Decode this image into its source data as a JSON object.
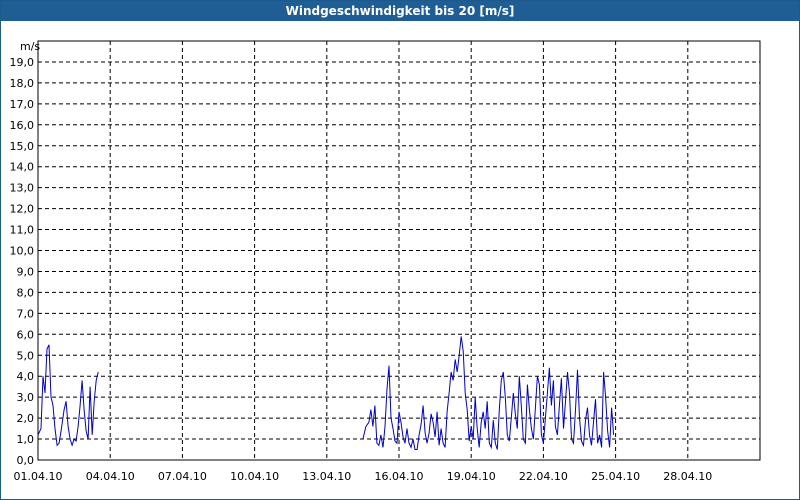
{
  "window": {
    "title": "Windgeschwindigkeit bis 20 [m/s]"
  },
  "chart_data": {
    "type": "line",
    "title": "Windgeschwindigkeit bis 20 [m/s]",
    "ylabel": "m/s",
    "xlabel": "",
    "ylim": [
      0,
      20
    ],
    "xlim": [
      "01.04.10",
      "30.04.10"
    ],
    "grid": true,
    "y_ticks": [
      "0,0",
      "1,0",
      "2,0",
      "3,0",
      "4,0",
      "5,0",
      "6,0",
      "7,0",
      "8,0",
      "9,0",
      "10,0",
      "11,0",
      "12,0",
      "13,0",
      "14,0",
      "15,0",
      "16,0",
      "17,0",
      "18,0",
      "19,0"
    ],
    "x_ticks": [
      "01.04.10",
      "04.04.10",
      "07.04.10",
      "10.04.10",
      "13.04.10",
      "16.04.10",
      "19.04.10",
      "22.04.10",
      "25.04.10",
      "28.04.10"
    ],
    "line_color": "#0000cc",
    "series": [
      {
        "segments": [
          [
            [
              "01.04.10 00:00",
              1.2
            ],
            [
              "01.04.10 03:00",
              1.5
            ],
            [
              "01.04.10 05:00",
              4.0
            ],
            [
              "01.04.10 07:00",
              3.2
            ],
            [
              "01.04.10 09:00",
              5.3
            ],
            [
              "01.04.10 11:00",
              5.5
            ],
            [
              "01.04.10 13:00",
              3.0
            ],
            [
              "01.04.10 15:00",
              2.6
            ],
            [
              "01.04.10 17:00",
              1.5
            ],
            [
              "01.04.10 19:00",
              0.7
            ],
            [
              "01.04.10 21:00",
              0.8
            ],
            [
              "01.04.10 23:00",
              1.4
            ],
            [
              "02.04.10 02:00",
              2.4
            ],
            [
              "02.04.10 04:00",
              2.8
            ],
            [
              "02.04.10 06:00",
              1.6
            ],
            [
              "02.04.10 08:00",
              1.0
            ],
            [
              "02.04.10 10:00",
              0.7
            ],
            [
              "02.04.10 12:00",
              1.0
            ],
            [
              "02.04.10 14:00",
              0.9
            ],
            [
              "02.04.10 16:00",
              1.6
            ],
            [
              "02.04.10 18:00",
              2.6
            ],
            [
              "02.04.10 20:00",
              3.8
            ],
            [
              "02.04.10 22:00",
              2.4
            ],
            [
              "03.04.10 00:00",
              1.4
            ],
            [
              "03.04.10 02:00",
              1.0
            ],
            [
              "03.04.10 04:00",
              3.5
            ],
            [
              "03.04.10 06:00",
              1.2
            ],
            [
              "03.04.10 08:00",
              2.8
            ],
            [
              "03.04.10 10:00",
              3.8
            ],
            [
              "03.04.10 12:00",
              4.2
            ]
          ],
          [
            [
              "14.04.10 12:00",
              1.0
            ],
            [
              "14.04.10 15:00",
              1.6
            ],
            [
              "14.04.10 18:00",
              1.8
            ],
            [
              "14.04.10 20:00",
              2.4
            ],
            [
              "14.04.10 22:00",
              1.6
            ],
            [
              "15.04.10 00:00",
              2.6
            ],
            [
              "15.04.10 02:00",
              0.8
            ],
            [
              "15.04.10 04:00",
              0.7
            ],
            [
              "15.04.10 06:00",
              1.2
            ],
            [
              "15.04.10 08:00",
              0.6
            ],
            [
              "15.04.10 10:00",
              1.6
            ],
            [
              "15.04.10 12:00",
              3.4
            ],
            [
              "15.04.10 14:00",
              4.5
            ],
            [
              "15.04.10 16:00",
              2.0
            ],
            [
              "15.04.10 18:00",
              1.5
            ],
            [
              "15.04.10 20:00",
              0.9
            ],
            [
              "15.04.10 22:00",
              0.8
            ],
            [
              "16.04.10 00:00",
              2.3
            ],
            [
              "16.04.10 02:00",
              1.8
            ],
            [
              "16.04.10 04:00",
              1.1
            ],
            [
              "16.04.10 06:00",
              0.8
            ],
            [
              "16.04.10 08:00",
              1.5
            ],
            [
              "16.04.10 10:00",
              0.8
            ],
            [
              "16.04.10 12:00",
              0.6
            ],
            [
              "16.04.10 14:00",
              1.0
            ],
            [
              "16.04.10 16:00",
              0.5
            ],
            [
              "16.04.10 18:00",
              0.5
            ],
            [
              "16.04.10 20:00",
              1.2
            ],
            [
              "16.04.10 22:00",
              1.7
            ],
            [
              "17.04.10 00:00",
              2.6
            ],
            [
              "17.04.10 02:00",
              1.3
            ],
            [
              "17.04.10 04:00",
              0.8
            ],
            [
              "17.04.10 06:00",
              1.3
            ],
            [
              "17.04.10 08:00",
              2.2
            ],
            [
              "17.04.10 10:00",
              1.8
            ],
            [
              "17.04.10 12:00",
              1.1
            ],
            [
              "17.04.10 14:00",
              2.3
            ],
            [
              "17.04.10 16:00",
              0.7
            ],
            [
              "17.04.10 18:00",
              1.5
            ],
            [
              "17.04.10 20:00",
              0.8
            ],
            [
              "17.04.10 22:00",
              0.6
            ],
            [
              "18.04.10 00:00",
              2.3
            ],
            [
              "18.04.10 02:00",
              3.2
            ],
            [
              "18.04.10 04:00",
              4.2
            ],
            [
              "18.04.10 06:00",
              3.8
            ],
            [
              "18.04.10 08:00",
              4.8
            ],
            [
              "18.04.10 10:00",
              4.2
            ],
            [
              "18.04.10 12:00",
              5.0
            ],
            [
              "18.04.10 14:00",
              5.9
            ],
            [
              "18.04.10 16:00",
              5.2
            ],
            [
              "18.04.10 18:00",
              3.2
            ],
            [
              "18.04.10 20:00",
              2.4
            ],
            [
              "18.04.10 22:00",
              0.9
            ],
            [
              "19.04.10 00:00",
              1.6
            ],
            [
              "19.04.10 02:00",
              1.0
            ],
            [
              "19.04.10 04:00",
              3.0
            ],
            [
              "19.04.10 06:00",
              1.5
            ],
            [
              "19.04.10 08:00",
              0.6
            ],
            [
              "19.04.10 10:00",
              1.8
            ],
            [
              "19.04.10 12:00",
              2.3
            ],
            [
              "19.04.10 14:00",
              1.5
            ],
            [
              "19.04.10 16:00",
              2.8
            ],
            [
              "19.04.10 18:00",
              0.8
            ],
            [
              "19.04.10 20:00",
              0.6
            ],
            [
              "19.04.10 22:00",
              1.9
            ],
            [
              "20.04.10 00:00",
              0.8
            ],
            [
              "20.04.10 02:00",
              0.5
            ],
            [
              "20.04.10 04:00",
              2.4
            ],
            [
              "20.04.10 06:00",
              3.8
            ],
            [
              "20.04.10 08:00",
              4.2
            ],
            [
              "20.04.10 10:00",
              3.0
            ],
            [
              "20.04.10 12:00",
              1.2
            ],
            [
              "20.04.10 14:00",
              0.9
            ],
            [
              "20.04.10 16:00",
              2.0
            ],
            [
              "20.04.10 18:00",
              3.2
            ],
            [
              "20.04.10 20:00",
              2.2
            ],
            [
              "20.04.10 22:00",
              1.5
            ],
            [
              "21.04.10 00:00",
              4.0
            ],
            [
              "21.04.10 02:00",
              2.6
            ],
            [
              "21.04.10 04:00",
              1.0
            ],
            [
              "21.04.10 06:00",
              0.8
            ],
            [
              "21.04.10 08:00",
              3.6
            ],
            [
              "21.04.10 10:00",
              2.4
            ],
            [
              "21.04.10 12:00",
              1.5
            ],
            [
              "21.04.10 14:00",
              1.0
            ],
            [
              "21.04.10 16:00",
              2.5
            ],
            [
              "21.04.10 18:00",
              4.0
            ],
            [
              "21.04.10 20:00",
              3.6
            ],
            [
              "21.04.10 22:00",
              1.2
            ],
            [
              "22.04.10 00:00",
              0.8
            ],
            [
              "22.04.10 02:00",
              2.0
            ],
            [
              "22.04.10 04:00",
              3.2
            ],
            [
              "22.04.10 06:00",
              4.4
            ],
            [
              "22.04.10 08:00",
              2.6
            ],
            [
              "22.04.10 10:00",
              3.8
            ],
            [
              "22.04.10 12:00",
              1.6
            ],
            [
              "22.04.10 14:00",
              1.2
            ],
            [
              "22.04.10 16:00",
              2.6
            ],
            [
              "22.04.10 18:00",
              3.9
            ],
            [
              "22.04.10 20:00",
              1.5
            ],
            [
              "22.04.10 22:00",
              2.8
            ],
            [
              "23.04.10 00:00",
              4.2
            ],
            [
              "23.04.10 02:00",
              3.2
            ],
            [
              "23.04.10 04:00",
              1.0
            ],
            [
              "23.04.10 06:00",
              0.8
            ],
            [
              "23.04.10 08:00",
              2.4
            ],
            [
              "23.04.10 10:00",
              4.3
            ],
            [
              "23.04.10 12:00",
              2.0
            ],
            [
              "23.04.10 14:00",
              0.9
            ],
            [
              "23.04.10 16:00",
              0.7
            ],
            [
              "23.04.10 18:00",
              1.9
            ],
            [
              "23.04.10 20:00",
              2.5
            ],
            [
              "23.04.10 22:00",
              1.2
            ],
            [
              "24.04.10 00:00",
              0.7
            ],
            [
              "24.04.10 02:00",
              1.8
            ],
            [
              "24.04.10 04:00",
              2.9
            ],
            [
              "24.04.10 06:00",
              0.8
            ],
            [
              "24.04.10 08:00",
              1.2
            ],
            [
              "24.04.10 10:00",
              0.6
            ],
            [
              "24.04.10 12:00",
              4.2
            ],
            [
              "24.04.10 14:00",
              3.0
            ],
            [
              "24.04.10 16:00",
              1.4
            ],
            [
              "24.04.10 18:00",
              0.6
            ],
            [
              "24.04.10 20:00",
              2.5
            ],
            [
              "24.04.10 22:00",
              1.2
            ]
          ]
        ]
      }
    ]
  }
}
